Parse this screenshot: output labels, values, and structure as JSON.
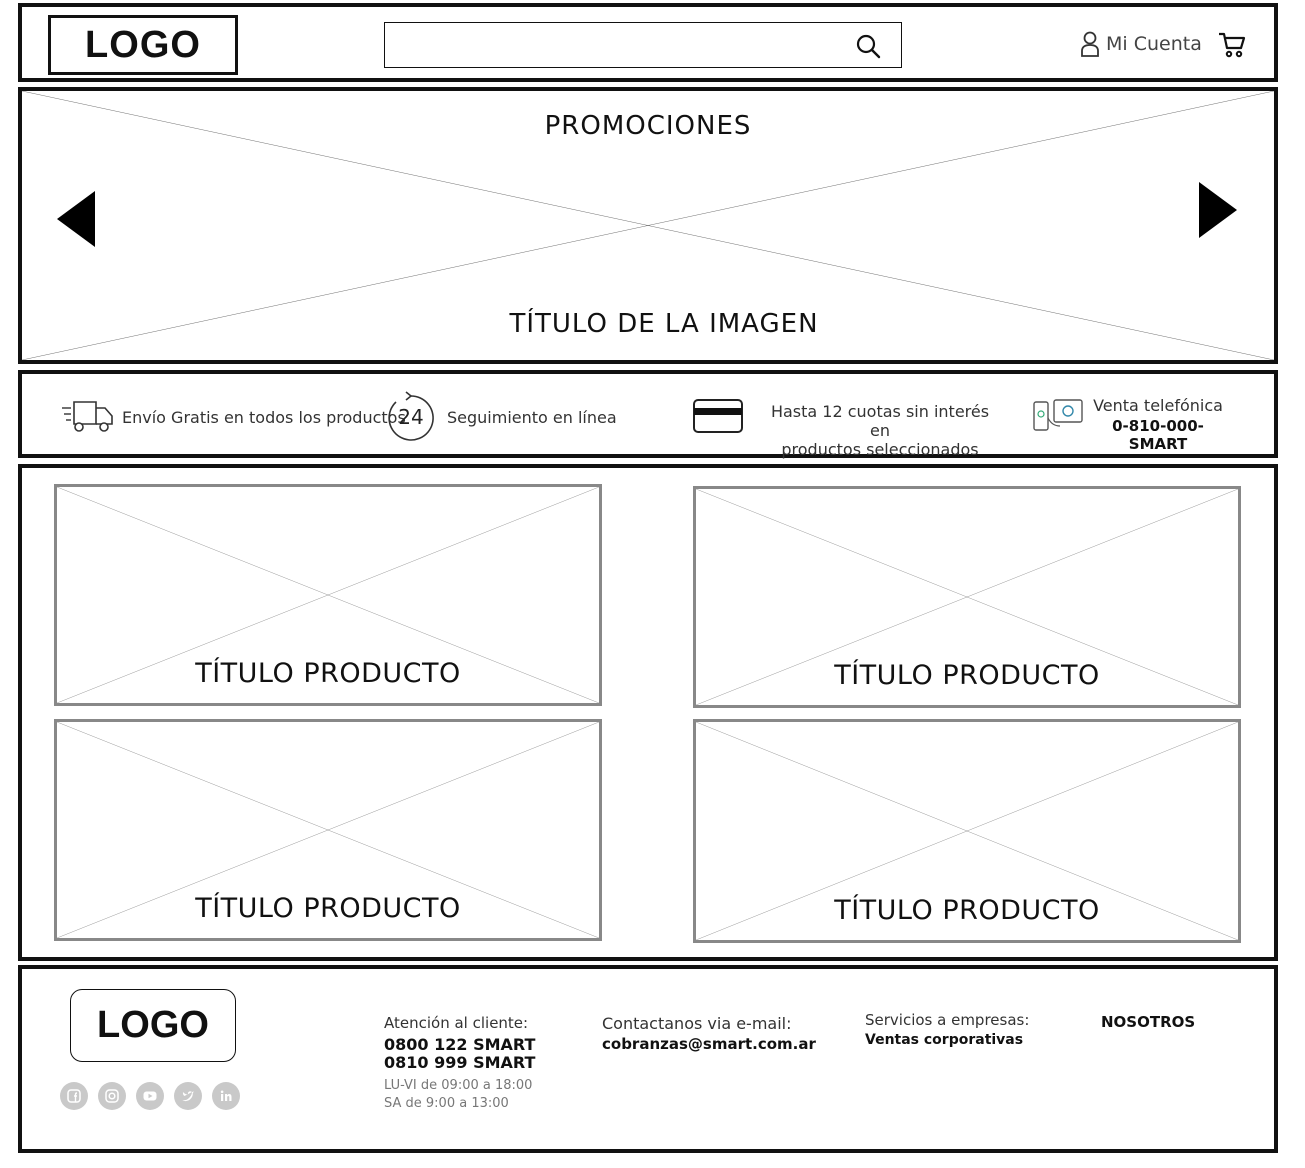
{
  "header": {
    "logo": "LOGO",
    "search_placeholder": "",
    "account_label": "Mi Cuenta",
    "icons": [
      "search-icon",
      "user-icon",
      "cart-icon"
    ]
  },
  "hero": {
    "top_text": "PROMOCIONES",
    "bottom_text": "TÍTULO DE LA IMAGEN",
    "icons": [
      "arrow-left-icon",
      "arrow-right-icon"
    ]
  },
  "benefits": {
    "shipping": "Envío Gratis en todos los productos",
    "tracking_number": "24",
    "tracking": "Seguimiento en línea",
    "installments_line1": "Hasta 12 cuotas sin interés en",
    "installments_line2": "productos seleccionados",
    "phone_label": "Venta telefónica",
    "phone_number": "0-810-000-SMART",
    "icons": [
      "truck-icon",
      "clock-24-icon",
      "credit-card-icon",
      "phone-sale-icon"
    ]
  },
  "products": [
    {
      "title": "TÍTULO PRODUCTO"
    },
    {
      "title": "TÍTULO PRODUCTO"
    },
    {
      "title": "TÍTULO PRODUCTO"
    },
    {
      "title": "TÍTULO PRODUCTO"
    }
  ],
  "footer": {
    "logo": "LOGO",
    "customer_service_label": "Atención al cliente:",
    "phone1": "0800 122 SMART",
    "phone2": "0810 999 SMART",
    "hours1": "LU-VI de 09:00 a 18:00",
    "hours2": "SA de 9:00 a 13:00",
    "email_label": "Contactanos via e-mail:",
    "email": "cobranzas@smart.com.ar",
    "business_label": "Servicios a empresas:",
    "business_link": "Ventas corporativas",
    "about": "NOSOTROS",
    "social": [
      "facebook-icon",
      "instagram-icon",
      "youtube-icon",
      "twitter-icon",
      "linkedin-icon"
    ]
  },
  "colors": {
    "border": "#111111",
    "placeholder_frame": "#888888",
    "social_icon": "#c9c9c9"
  }
}
